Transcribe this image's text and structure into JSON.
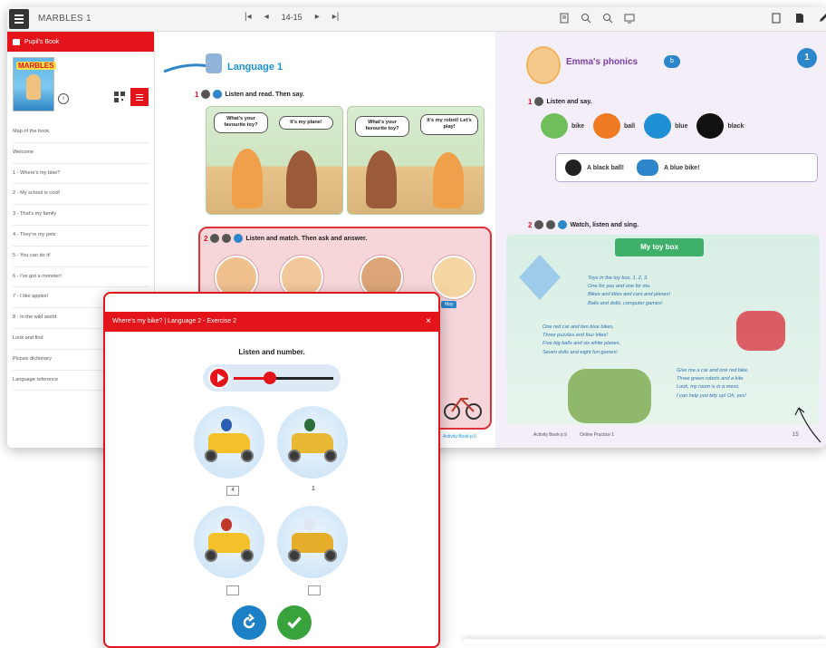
{
  "app": {
    "title": "MARBLES 1",
    "page_range": "14-15"
  },
  "sidebar": {
    "header_label": "Pupil's Book",
    "cover_logo": "MARBLES",
    "items": [
      "Map of the book",
      "Welcome",
      "1 - Where's my bike?",
      "2 - My school is cool!",
      "3 - That's my family",
      "4 - They're my pets",
      "5 - You can do it!",
      "6 - I've got a monster!",
      "7 - I like apples!",
      "8 - In the wild world",
      "Look and find",
      "Picture dictionary",
      "Language reference"
    ]
  },
  "left_page": {
    "title": "Language 1",
    "ex1": {
      "num": "1",
      "instruction": "Listen and read. Then say."
    },
    "panel1": {
      "q": "What's your favourite toy?",
      "a": "It's my plane!"
    },
    "panel2": {
      "q": "What's your favourite toy?",
      "a": "It's my robot! Let's play!"
    },
    "ex2": {
      "num": "2",
      "instruction": "Listen and match. Then ask and answer."
    },
    "name_tag": "May",
    "footer_link": "Activity Book p.6"
  },
  "right_page": {
    "title": "Emma's phonics",
    "badge": "b",
    "page_badge": "1",
    "ex1": {
      "num": "1",
      "instruction": "Listen and say."
    },
    "words": [
      "bike",
      "ball",
      "blue",
      "black"
    ],
    "phrases": [
      "A black ball!",
      "A blue bike!"
    ],
    "ex2": {
      "num": "2",
      "instruction": "Watch, listen and sing."
    },
    "song_title": "My toy box",
    "verse1": [
      "Toys in the toy box, 1, 2, 3.",
      "One for you and one for me.",
      "Bikes and kites and cars and planes!",
      "Balls and dolls, computer games!"
    ],
    "verse2": [
      "One red car and two blue bikes,",
      "Three puzzles and four kites!",
      "Five big balls and six white planes,",
      "Seven dolls and eight fun games!"
    ],
    "verse3": [
      "Give me a car and one red bike,",
      "Three green robots and a kite.",
      "Look, my room is in a mess.",
      "I can help you tidy up! Oh, yes!"
    ],
    "footer_links": [
      "Activity Book p.9",
      "Online Practice 1"
    ],
    "page_number": "15"
  },
  "modal": {
    "title": "Where's my bike? | Language 2 - Exercise 2",
    "close": "×",
    "subtitle": "Listen and number.",
    "progress": 0.36,
    "answers": [
      "4",
      "1",
      "",
      ""
    ],
    "reset_label": "↻",
    "check_label": "✓"
  }
}
